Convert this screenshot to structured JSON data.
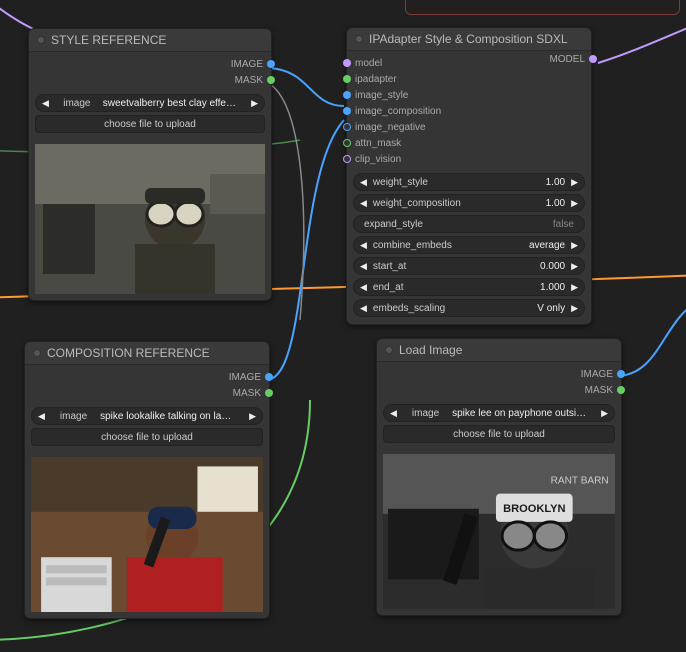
{
  "style_ref": {
    "title": "STYLE REFERENCE",
    "out_image": "IMAGE",
    "out_mask": "MASK",
    "image_label": "image",
    "image_value": "sweetvalberry best clay effects - …",
    "upload_btn": "choose file to upload"
  },
  "comp_ref": {
    "title": "COMPOSITION REFERENCE",
    "out_image": "IMAGE",
    "out_mask": "MASK",
    "image_label": "image",
    "image_value": "spike lookalike talking on landlin…",
    "upload_btn": "choose file to upload"
  },
  "load_image": {
    "title": "Load Image",
    "out_image": "IMAGE",
    "out_mask": "MASK",
    "image_label": "image",
    "image_value": "spike lee on payphone outside b…",
    "upload_btn": "choose file to upload"
  },
  "ipadapter": {
    "title": "IPAdapter Style & Composition SDXL",
    "out_model": "MODEL",
    "in_ports": [
      "model",
      "ipadapter",
      "image_style",
      "image_composition",
      "image_negative",
      "attn_mask",
      "clip_vision"
    ],
    "widgets": {
      "weight_style": {
        "label": "weight_style",
        "value": "1.00"
      },
      "weight_composition": {
        "label": "weight_composition",
        "value": "1.00"
      },
      "expand_style": {
        "label": "expand_style",
        "value": "false"
      },
      "combine_embeds": {
        "label": "combine_embeds",
        "value": "average"
      },
      "start_at": {
        "label": "start_at",
        "value": "0.000"
      },
      "end_at": {
        "label": "end_at",
        "value": "1.000"
      },
      "embeds_scaling": {
        "label": "embeds_scaling",
        "value": "V only"
      }
    }
  },
  "colors": {
    "blue": "#4aa3ff",
    "green": "#66cc66",
    "orange": "#ff9933",
    "purple": "#c09aff",
    "grey": "#888"
  }
}
